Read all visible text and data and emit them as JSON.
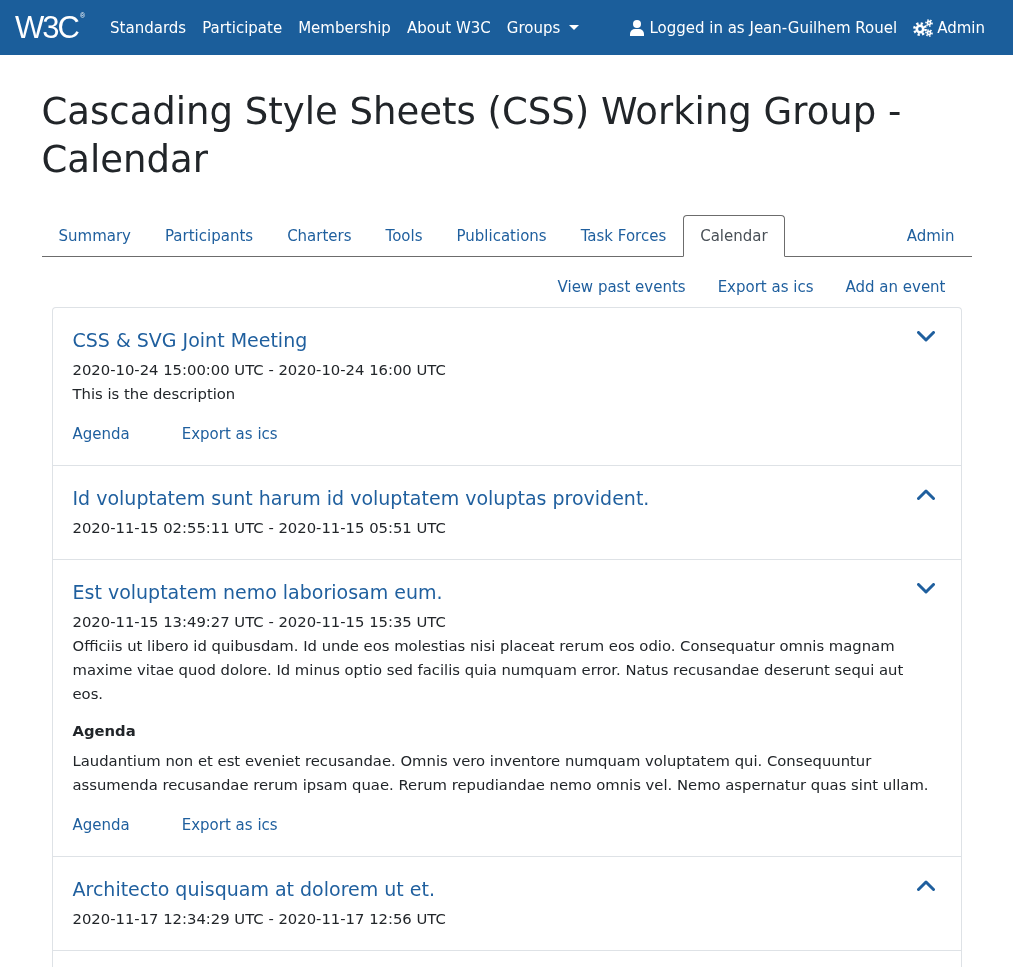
{
  "navbar": {
    "logo": "W3C",
    "logo_mark": "®",
    "items": [
      {
        "label": "Standards",
        "dropdown": false
      },
      {
        "label": "Participate",
        "dropdown": false
      },
      {
        "label": "Membership",
        "dropdown": false
      },
      {
        "label": "About W3C",
        "dropdown": false
      },
      {
        "label": "Groups",
        "dropdown": true
      }
    ],
    "user": "Logged in as Jean-Guilhem Rouel",
    "admin": "Admin"
  },
  "page_title": "Cascading Style Sheets (CSS) Working Group - Calendar",
  "tabs": [
    {
      "label": "Summary",
      "selected": false
    },
    {
      "label": "Participants",
      "selected": false
    },
    {
      "label": "Charters",
      "selected": false
    },
    {
      "label": "Tools",
      "selected": false
    },
    {
      "label": "Publications",
      "selected": false
    },
    {
      "label": "Task Forces",
      "selected": false
    },
    {
      "label": "Calendar",
      "selected": true
    },
    {
      "label": "Admin",
      "selected": false
    }
  ],
  "actions": [
    "View past events",
    "Export as ics",
    "Add an event"
  ],
  "events": [
    {
      "title": "CSS & SVG Joint Meeting",
      "time": "2020-10-24 15:00:00 UTC - 2020-10-24 16:00 UTC",
      "expanded": true,
      "description": "This is the description",
      "links": [
        "Agenda",
        "Export as ics"
      ]
    },
    {
      "title": "Id voluptatem sunt harum id voluptatem voluptas provident.",
      "time": "2020-11-15 02:55:11 UTC - 2020-11-15 05:51 UTC",
      "expanded": false
    },
    {
      "title": "Est voluptatem nemo laboriosam eum.",
      "time": "2020-11-15 13:49:27 UTC - 2020-11-15 15:35 UTC",
      "expanded": true,
      "description": "Officiis ut libero id quibusdam. Id unde eos molestias nisi placeat rerum eos odio. Consequatur omnis magnam maxime vitae quod dolore. Id minus optio sed facilis quia numquam error. Natus recusandae deserunt sequi aut eos.",
      "agenda_heading": "Agenda",
      "agenda": "Laudantium non et est eveniet recusandae. Omnis vero inventore numquam voluptatem qui. Consequuntur assumenda recusandae rerum ipsam quae. Rerum repudiandae nemo omnis vel. Nemo aspernatur quas sint ullam.",
      "links": [
        "Agenda",
        "Export as ics"
      ]
    },
    {
      "title": "Architecto quisquam at dolorem ut et.",
      "time": "2020-11-17 12:34:29 UTC - 2020-11-17 12:56 UTC",
      "expanded": false
    }
  ]
}
